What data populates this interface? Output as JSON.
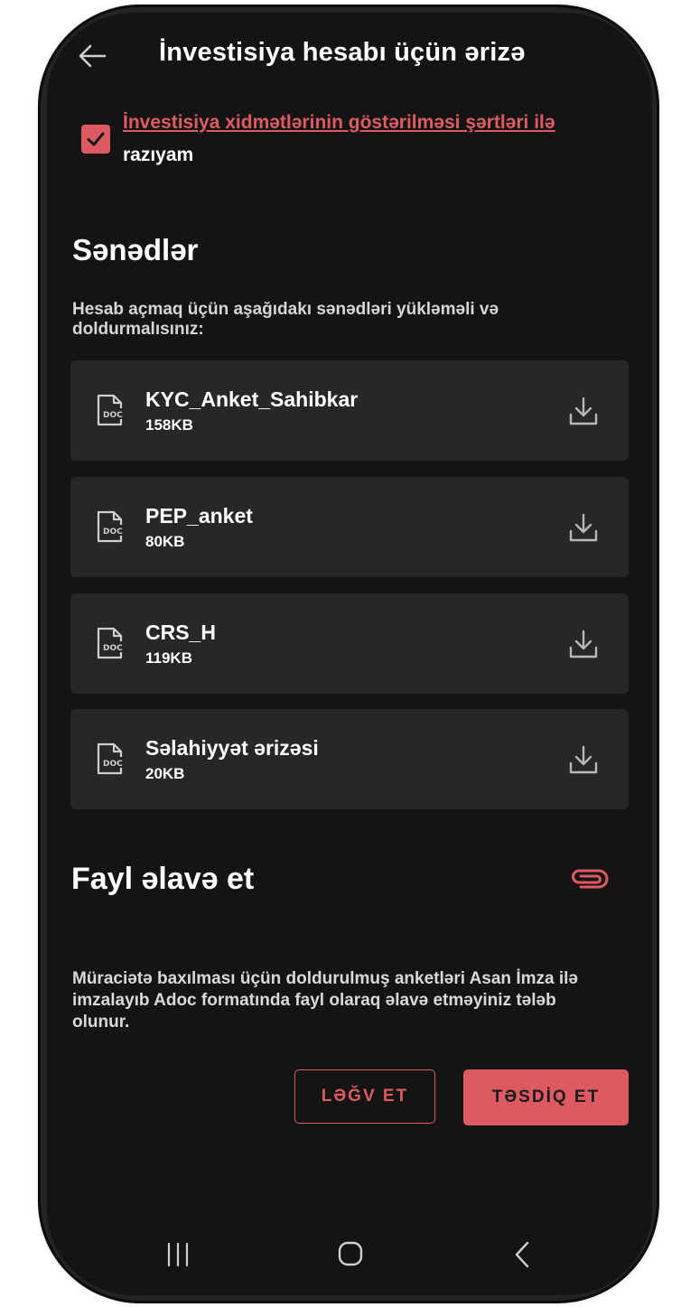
{
  "header": {
    "title": "İnvestisiya hesabı üçün ərizə",
    "back_icon": "arrow-left-icon"
  },
  "agreement": {
    "checked": true,
    "link_text": "İnvestisiya xidmətlərinin göstərilməsi şərtləri ilə",
    "suffix_text": "razıyam"
  },
  "documents": {
    "title": "Sənədlər",
    "description": "Hesab açmaq üçün aşağıdakı sənədləri yükləməli və doldurmalısınız:",
    "items": [
      {
        "name": "KYC_Anket_Sahibkar",
        "size": "158KB"
      },
      {
        "name": "PEP_anket",
        "size": "80KB"
      },
      {
        "name": "CRS_H",
        "size": "119KB"
      },
      {
        "name": "Səlahiyyət ərizəsi",
        "size": "20KB"
      }
    ],
    "file_icon": "doc-file-icon",
    "download_icon": "download-icon"
  },
  "attach": {
    "title": "Fayl əlavə et",
    "icon": "paperclip-icon",
    "notice": "Müraciətə baxılması üçün doldurulmuş anketləri Asan İmza ilə imzalayıb Adoc formatında fayl olaraq əlavə etməyiniz tələb olunur."
  },
  "actions": {
    "cancel_label": "LƏĞV ET",
    "confirm_label": "TƏSDİQ ET"
  },
  "colors": {
    "accent": "#de5a62",
    "background": "#141414",
    "card": "#272727"
  }
}
